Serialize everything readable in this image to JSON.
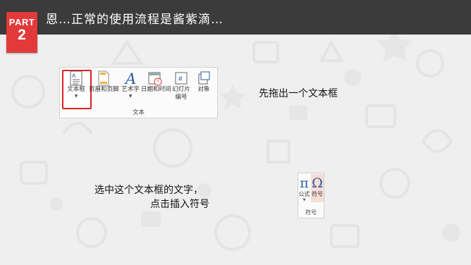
{
  "header": {
    "title": "恩…正常的使用流程是酱紫滴…",
    "badge_label": "PART",
    "badge_number": "2"
  },
  "ribbon": {
    "items": [
      {
        "label": "文本框",
        "icon": "textbox-icon"
      },
      {
        "label": "页眉和页脚",
        "icon": "header-footer-icon"
      },
      {
        "label": "艺术字",
        "icon": "wordart-icon"
      },
      {
        "label": "日期和时间",
        "icon": "calendar-icon"
      },
      {
        "label": "幻灯片",
        "label2": "编号",
        "icon": "slide-number-icon"
      },
      {
        "label": "对象",
        "icon": "object-icon"
      }
    ],
    "group_label": "文本"
  },
  "notes": {
    "step1": "先拖出一个文本框",
    "step2_line1": "选中这个文本框的文字，",
    "step2_line2": "点击插入符号"
  },
  "symbols": {
    "equation_glyph": "π",
    "equation_label": "公式",
    "symbol_glyph": "Ω",
    "symbol_label": "符号",
    "group_label": "符号"
  },
  "colors": {
    "topbar": "#3b3b3b",
    "badge": "#e23a3a",
    "selection": "#e02020",
    "symbol_highlight": "#f7dcd6"
  }
}
